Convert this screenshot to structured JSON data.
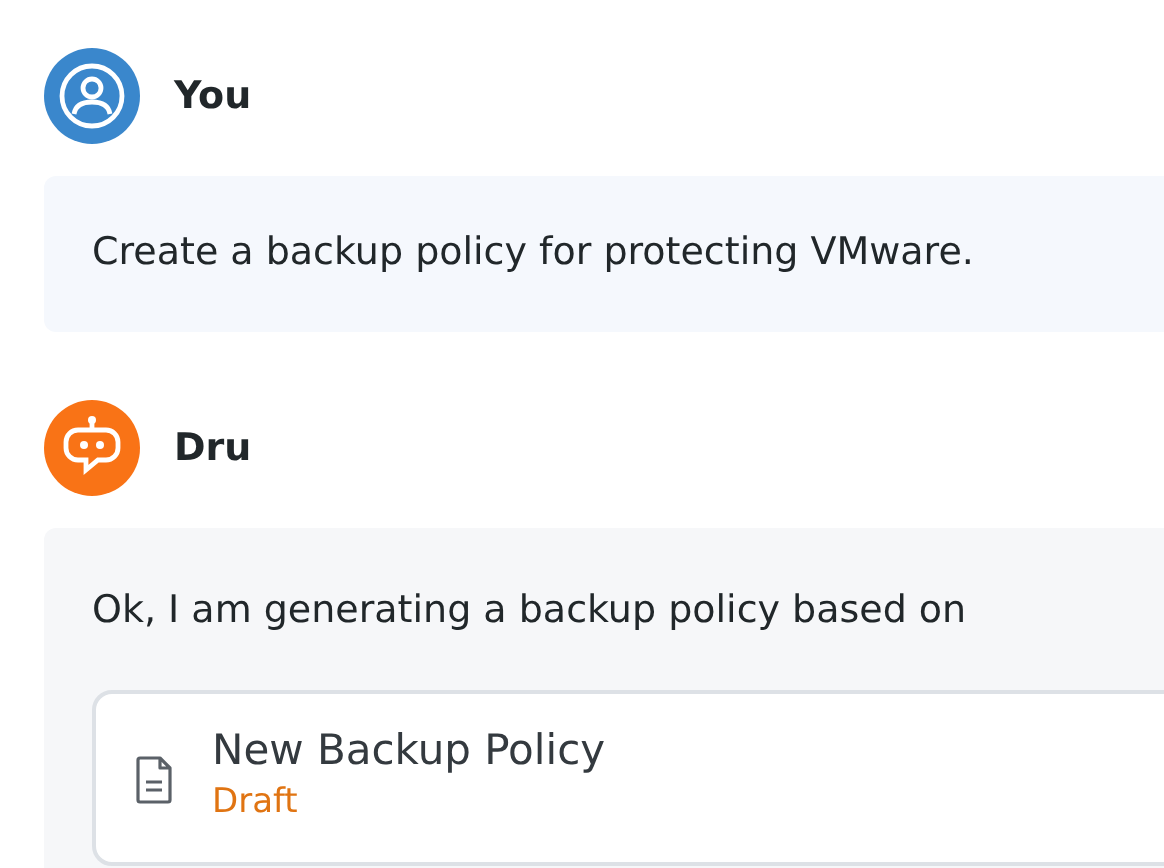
{
  "messages": [
    {
      "kind": "user",
      "author": "You",
      "text": "Create a backup policy for protecting VMware."
    },
    {
      "kind": "assistant",
      "author": "Dru",
      "text": "Ok, I am generating a backup policy based on",
      "attachment": {
        "title": "New Backup Policy",
        "status": "Draft"
      }
    }
  ]
}
